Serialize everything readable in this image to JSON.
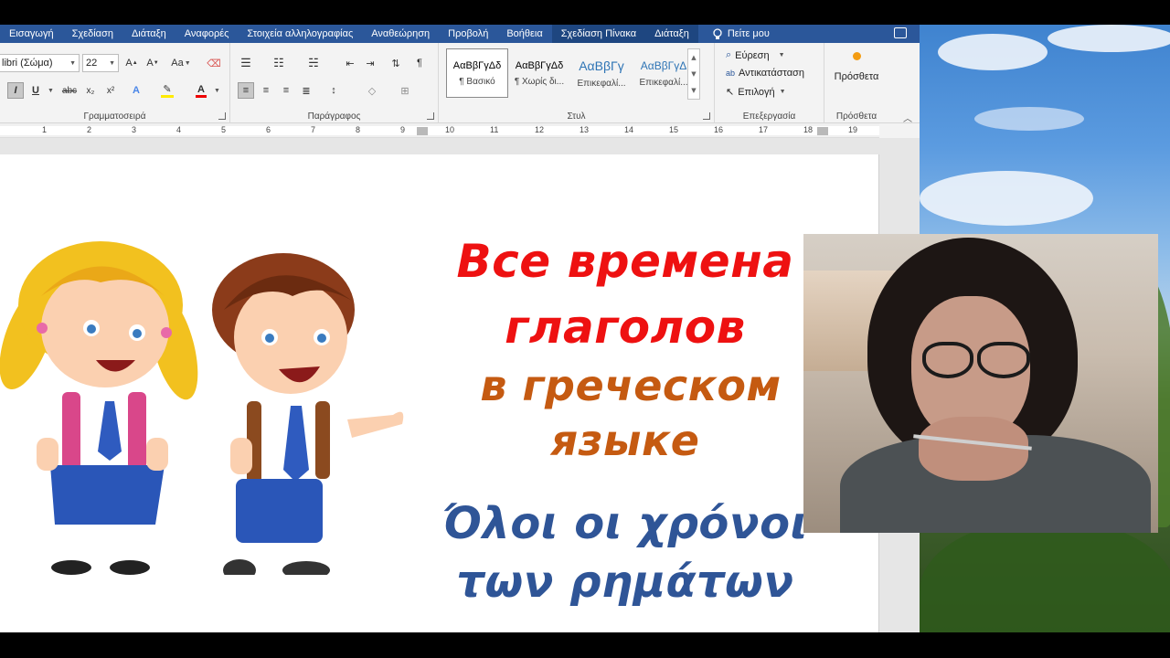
{
  "ribbon_tabs": [
    "Εισαγωγή",
    "Σχεδίαση",
    "Διάταξη",
    "Αναφορές",
    "Στοιχεία αλληλογραφίας",
    "Αναθεώρηση",
    "Προβολή",
    "Βοήθεια",
    "Σχεδίαση Πίνακα",
    "Διάταξη"
  ],
  "tell_me": "Πείτε μου",
  "font": {
    "name": "libri (Σώμα)",
    "size": "22",
    "group_label": "Γραμματοσειρά"
  },
  "paragraph": {
    "group_label": "Παράγραφος"
  },
  "styles": {
    "group_label": "Στυλ",
    "items": [
      {
        "preview": "AαΒβΓγΔδ",
        "name": "¶ Βασικό"
      },
      {
        "preview": "AαΒβΓγΔδ",
        "name": "¶ Χωρίς δι..."
      },
      {
        "preview": "AαΒβΓγ",
        "name": "Επικεφαλί..."
      },
      {
        "preview": "AαΒβΓγΔ",
        "name": "Επικεφαλί..."
      }
    ]
  },
  "editing": {
    "group_label": "Επεξεργασία",
    "find": "Εύρεση",
    "replace": "Αντικατάσταση",
    "select": "Επιλογή"
  },
  "addins": {
    "button": "Πρόσθετα",
    "group_label": "Πρόσθετα"
  },
  "ruler_numbers": [
    "1",
    "2",
    "3",
    "4",
    "5",
    "6",
    "7",
    "8",
    "9",
    "10",
    "11",
    "12",
    "13",
    "14",
    "15",
    "16",
    "17",
    "18",
    "19"
  ],
  "document": {
    "line1": "Все времена",
    "line2": "глаголов",
    "line3": "в греческом",
    "line4": "языке",
    "line5": "Όλοι οι χρόνοι",
    "line6": "των ρημάτων"
  },
  "colors": {
    "ribbon_tab_bar": "#2b579a",
    "title_red": "#ee1111",
    "title_orange": "#c55a11",
    "title_blue": "#2f5597"
  }
}
